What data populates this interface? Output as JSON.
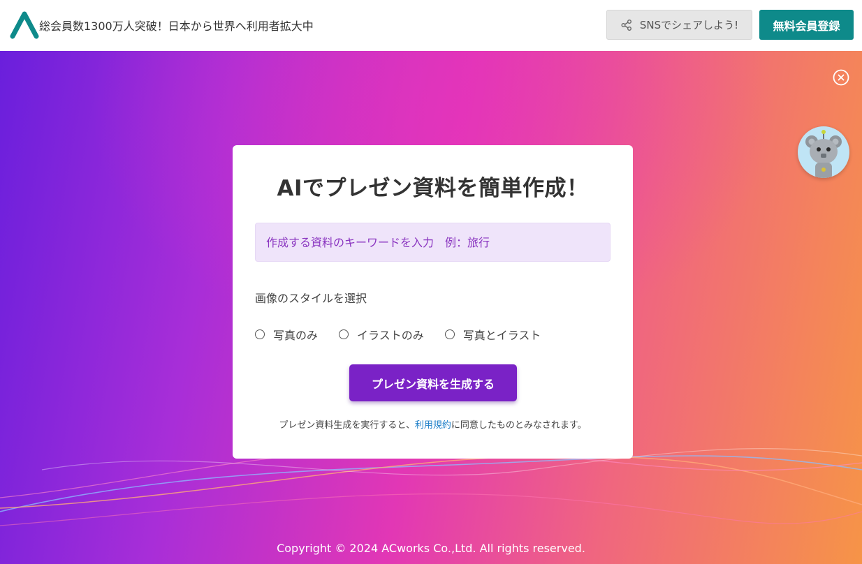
{
  "header": {
    "tagline": "総会員数1300万人突破！日本から世界へ利用者拡大中",
    "share_label": "SNSでシェアしよう!",
    "register_label": "無料会員登録"
  },
  "card": {
    "title": "AIでプレゼン資料を簡単作成！",
    "keyword_placeholder": "作成する資料のキーワードを入力　例：旅行",
    "style_label": "画像のスタイルを選択",
    "style_options": [
      "写真のみ",
      "イラストのみ",
      "写真とイラスト"
    ],
    "generate_label": "プレゼン資料を生成する",
    "terms_prefix": "プレゼン資料生成を実行すると、",
    "terms_link": "利用規約",
    "terms_suffix": "に同意したものとみなされます。"
  },
  "footer": {
    "copyright": "Copyright © 2024 ACworks Co.,Ltd. All rights reserved."
  },
  "colors": {
    "brand_teal": "#0e8a8a",
    "primary_purple": "#7a22c6",
    "input_bg": "#efe4fa",
    "link_blue": "#1e7fc8"
  },
  "icons": [
    "logo-icon",
    "share-icon",
    "close-circle-icon",
    "robot-mascot-icon"
  ]
}
